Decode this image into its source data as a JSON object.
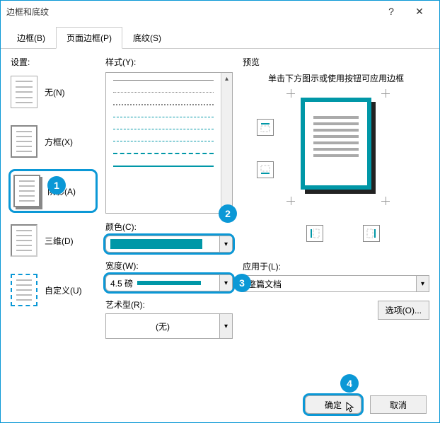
{
  "window": {
    "title": "边框和底纹"
  },
  "tabs": {
    "border": "边框(B)",
    "pageBorder": "页面边框(P)",
    "shading": "底纹(S)"
  },
  "settings": {
    "label": "设置:",
    "items": [
      {
        "label": "无(N)"
      },
      {
        "label": "方框(X)"
      },
      {
        "label": "阴影(A)"
      },
      {
        "label": "三维(D)"
      },
      {
        "label": "自定义(U)"
      }
    ]
  },
  "style": {
    "label": "样式(Y):"
  },
  "color": {
    "label": "颜色(C):",
    "value": "#0097a7"
  },
  "width": {
    "label": "宽度(W):",
    "value": "4.5 磅"
  },
  "art": {
    "label": "艺术型(R):",
    "value": "(无)"
  },
  "preview": {
    "label": "预览",
    "hint": "单击下方图示或使用按钮可应用边框"
  },
  "applyTo": {
    "label": "应用于(L):",
    "value": "整篇文档"
  },
  "optionsBtn": "选项(O)...",
  "ok": "确定",
  "cancel": "取消",
  "annotations": {
    "a1": "1",
    "a2": "2",
    "a3": "3",
    "a4": "4"
  }
}
